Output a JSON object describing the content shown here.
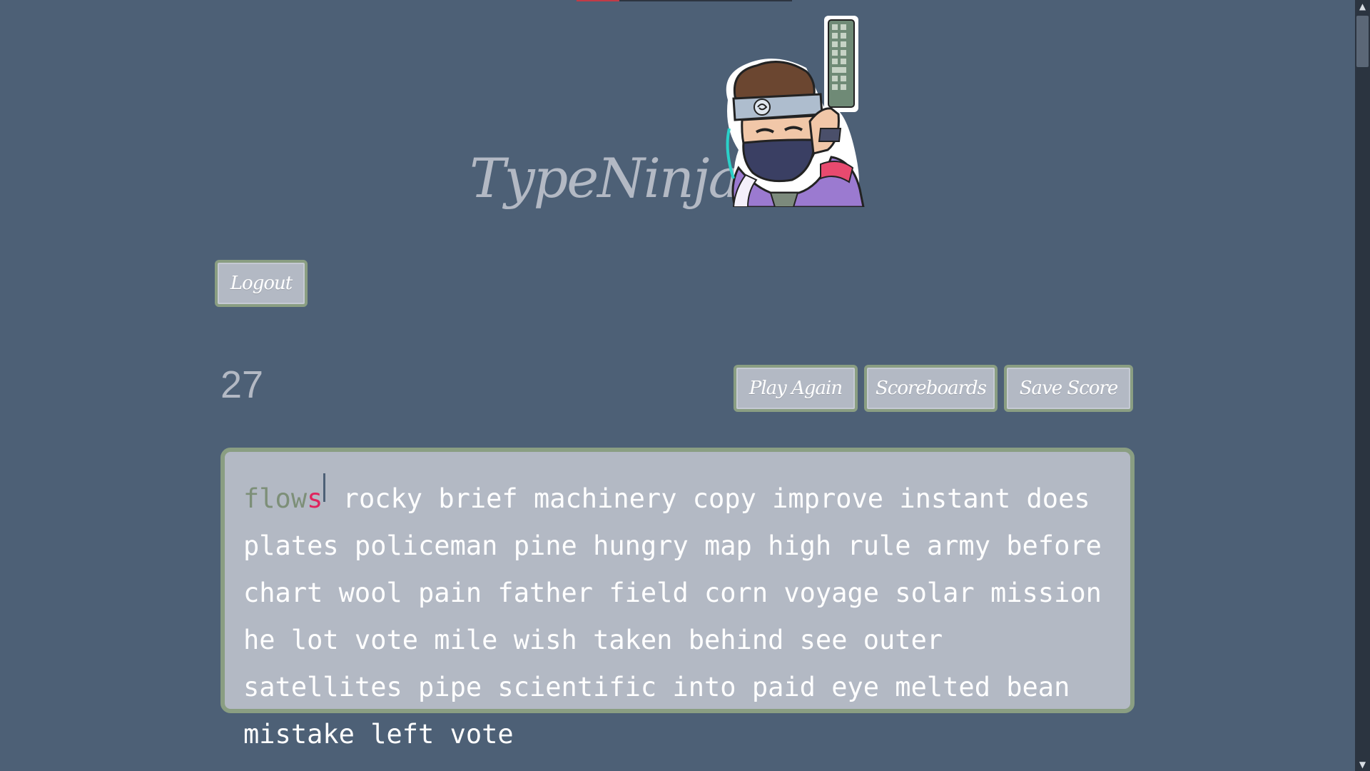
{
  "app": {
    "title": "TypeNinja"
  },
  "progress": {
    "fraction": 0.2
  },
  "buttons": {
    "logout": "Logout",
    "play_again": "Play Again",
    "scoreboards": "Scoreboards",
    "save_score": "Save Score"
  },
  "timer": {
    "value": "27"
  },
  "typing": {
    "current_word_correct": "flow",
    "current_word_wrong": "s",
    "remaining_text": "rocky brief machinery copy improve instant does plates policeman pine hungry map high rule army before chart wool pain father field corn voyage solar mission he lot vote mile wish taken behind see outer satellites pipe scientific into paid eye melted bean mistake left vote"
  },
  "icons": {
    "mascot": "ninja-mascot-icon",
    "scroll_up": "chevron-up-icon",
    "scroll_down": "chevron-down-icon"
  },
  "colors": {
    "background": "#4d6076",
    "panel": "#b3b9c4",
    "border": "#8a9e82",
    "correct": "#7d8f78",
    "error": "#e0245e"
  }
}
